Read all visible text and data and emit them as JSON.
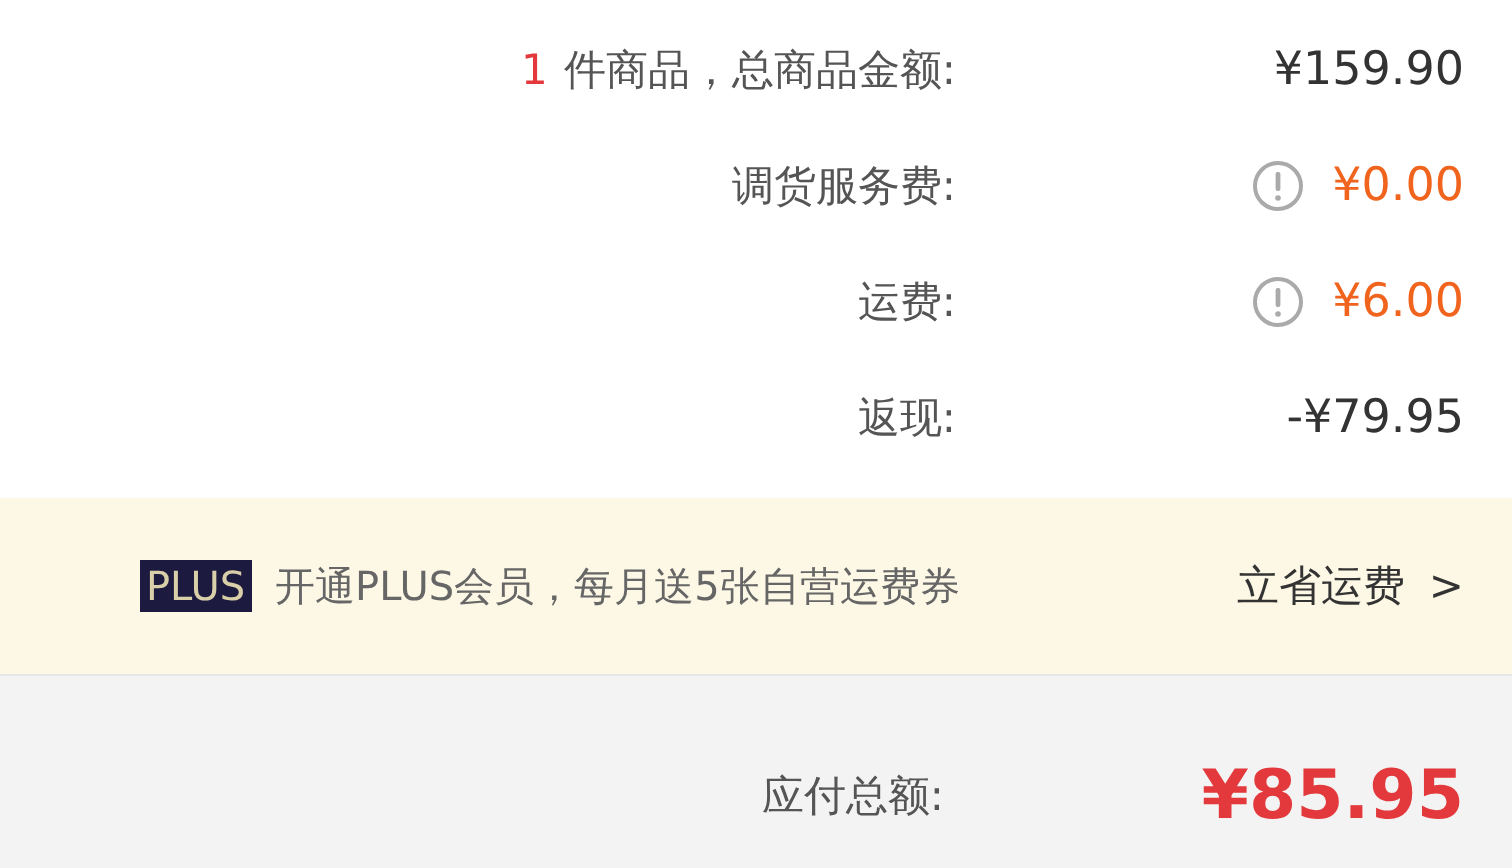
{
  "summary": [
    {
      "count": "1",
      "label": "件商品，总商品金额:",
      "amount": "¥159.90",
      "info": false,
      "highlight": false
    },
    {
      "label": "调货服务费:",
      "amount": "¥0.00",
      "info": true,
      "highlight": true
    },
    {
      "label": "运费:",
      "amount": "¥6.00",
      "info": true,
      "highlight": true
    },
    {
      "label": "返现:",
      "amount": "-¥79.95",
      "info": false,
      "highlight": false
    }
  ],
  "plus_banner": {
    "badge": "PLUS",
    "text": "开通PLUS会员，每月送5张自营运费券",
    "link": "立省运费",
    "chevron": ">"
  },
  "total": {
    "label": "应付总额:",
    "amount": "¥85.95"
  }
}
